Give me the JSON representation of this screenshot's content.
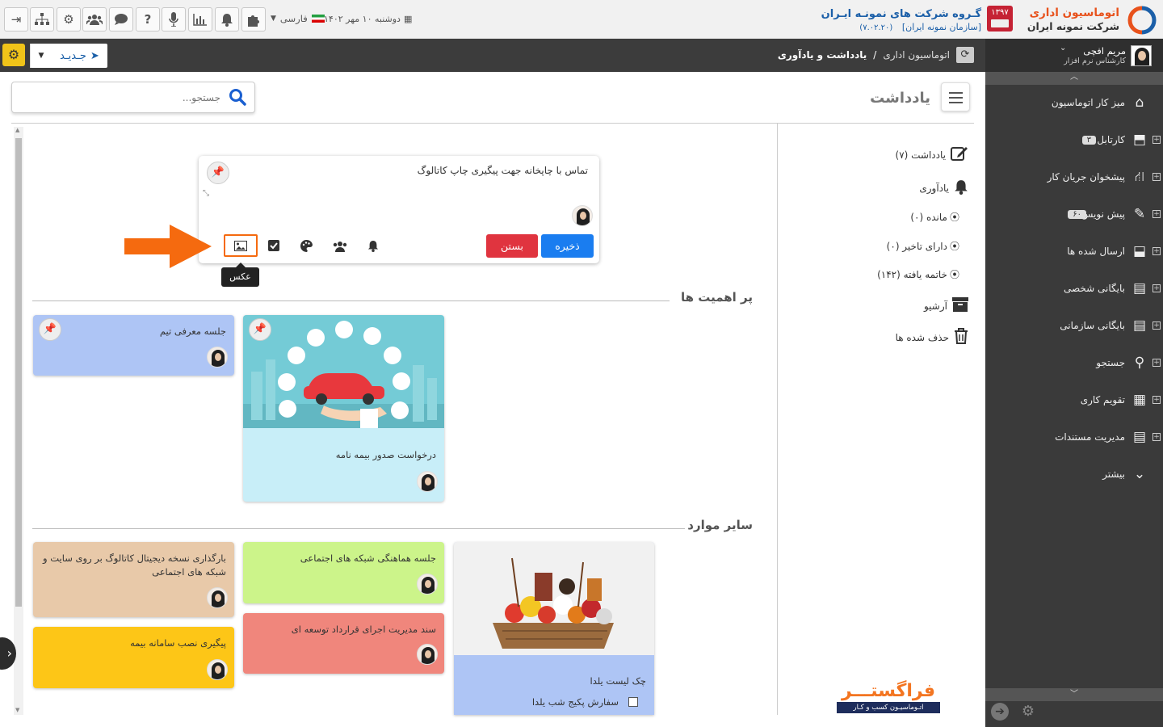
{
  "topbar": {
    "company_brand": "اتوماسیون اداری",
    "company_name": "شرکت نمونه ایران",
    "app_badge": "۱۳۹۷",
    "group_title": "گـروه شرکت های نمونـه ایـران",
    "org_name": "[سازمان نمونه ایران]",
    "version": "(۷.۰۲.۲۰)",
    "date": "دوشنبه ۱۰ مهر ۱۴۰۲",
    "language": "فارسی",
    "icons": [
      "exit-icon",
      "org-chart-icon",
      "gear-icon",
      "users-icon",
      "chat-icon",
      "help-icon",
      "microphone-icon",
      "chart-icon",
      "bell-icon",
      "puzzle-icon"
    ]
  },
  "bar2": {
    "breadcrumb_root": "اتوماسیون اداری",
    "breadcrumb_sep": "/",
    "breadcrumb_current": "یادداشت و یادآوری",
    "new_button": "جـدیـد"
  },
  "user": {
    "name": "مریم افچی",
    "role": "کارشناس نرم افزار"
  },
  "sidebar": {
    "items": [
      {
        "label": "میز کار اتوماسیون",
        "icon": "home-icon",
        "badge": "",
        "expand": false
      },
      {
        "label": "کارتابل",
        "icon": "inbox-icon",
        "badge": "۳",
        "expand": true
      },
      {
        "label": "پیشخوان جریان کار",
        "icon": "workflow-icon",
        "badge": "",
        "expand": true
      },
      {
        "label": "پیش نویس",
        "icon": "draft-icon",
        "badge": "۶۰",
        "expand": true
      },
      {
        "label": "ارسال شده ها",
        "icon": "outbox-icon",
        "badge": "",
        "expand": true
      },
      {
        "label": "بایگانی شخصی",
        "icon": "archive-icon",
        "badge": "",
        "expand": true
      },
      {
        "label": "بایگانی سازمانی",
        "icon": "org-archive-icon",
        "badge": "",
        "expand": true
      },
      {
        "label": "جستجو",
        "icon": "search-icon",
        "badge": "",
        "expand": true
      },
      {
        "label": "تقویم کاری",
        "icon": "calendar-icon",
        "badge": "",
        "expand": true
      },
      {
        "label": "مدیریت مستندات",
        "icon": "documents-icon",
        "badge": "",
        "expand": true
      },
      {
        "label": "بیشتر",
        "icon": "chevron-down-icon",
        "badge": "",
        "expand": false
      }
    ]
  },
  "page": {
    "title": "یادداشت",
    "search_placeholder": "جستجو..."
  },
  "notes_menu": {
    "notes": "یادداشت (۷)",
    "reminders": "یادآوری",
    "remaining": "مانده (۰)",
    "delayed": "دارای تاخیر (۰)",
    "finished": "خاتمه یافته (۱۴۲)",
    "archive": "آرشیو",
    "deleted": "حذف شده ها"
  },
  "composer": {
    "text": "تماس با چاپخانه جهت پیگیری چاپ کاتالوگ",
    "save": "ذخیره",
    "close": "بستن",
    "tooltip": "عکس"
  },
  "sections": {
    "important": "پر اهمیت ها",
    "others": "سایر موارد"
  },
  "notes": {
    "team_meeting": "جلسه معرفی تیم",
    "insurance_request": "درخواست صدور بیمه نامه",
    "catalog_upload": "بارگذاری نسخه دیجیتال کاتالوگ بر روی سایت و شبکه های اجتماعی",
    "social_meeting": "جلسه هماهنگی شبکه های اجتماعی",
    "checklist_title": "چک لیست یلدا",
    "checklist_item": "سفارش پکیج شب یلدا",
    "insurance_install": "پیگیری نصب سامانه بیمه",
    "contract_doc": "سند مدیریت اجرای قرارداد توسعه ای"
  },
  "watermark": {
    "brand": "فراگستـــر",
    "tagline": "اتـوماسیـون کسب و کـار"
  },
  "colors": {
    "accent_blue": "#1a7df0",
    "danger_red": "#e0343f",
    "sidebar_bg": "#3a3a3a",
    "note_blue": "#aec5f5",
    "note_cyan": "#c8eef8",
    "note_beige": "#e8c9a9",
    "note_lime": "#ccf48a",
    "note_yellow": "#fdc617",
    "note_salmon": "#f0867c",
    "arrow_orange": "#f56a0f"
  }
}
